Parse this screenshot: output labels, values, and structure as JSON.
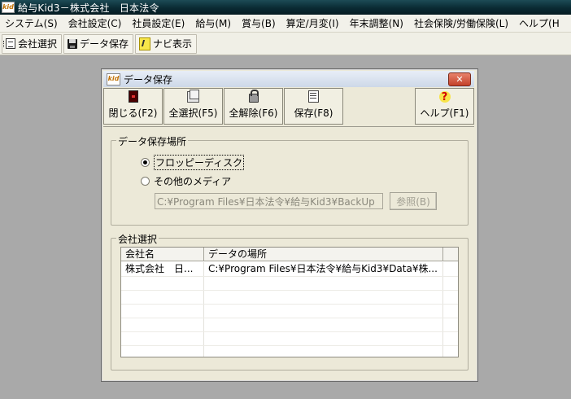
{
  "app": {
    "title": "給与Kid3－株式会社　日本法令",
    "icon_text": "kid"
  },
  "menubar": {
    "items": [
      {
        "label": "システム(S)"
      },
      {
        "label": "会社設定(C)"
      },
      {
        "label": "社員設定(E)"
      },
      {
        "label": "給与(M)"
      },
      {
        "label": "賞与(B)"
      },
      {
        "label": "算定/月変(I)"
      },
      {
        "label": "年末調整(N)"
      },
      {
        "label": "社会保険/労働保険(L)"
      },
      {
        "label": "ヘルプ(H"
      }
    ]
  },
  "toolbar": {
    "company_select": "会社選択",
    "data_save": "データ保存",
    "navi_display": "ナビ表示"
  },
  "dialog": {
    "title": "データ保存",
    "close_glyph": "✕",
    "buttons": {
      "close": "閉じる(F2)",
      "select_all": "全選択(F5)",
      "deselect_all": "全解除(F6)",
      "save": "保存(F8)",
      "help": "ヘルプ(F1)"
    },
    "save_location": {
      "legend": "データ保存場所",
      "option_floppy": "フロッピーディスク",
      "option_other": "その他のメディア",
      "selected": "floppy",
      "path_value": "C:¥Program Files¥日本法令¥給与Kid3¥BackUp",
      "browse_label": "参照(B)"
    },
    "company_select": {
      "legend": "会社選択",
      "columns": [
        "会社名",
        "データの場所"
      ],
      "rows": [
        [
          "株式会社　日...",
          "C:¥Program Files¥日本法令¥給与Kid3¥Data¥株..."
        ]
      ]
    }
  }
}
